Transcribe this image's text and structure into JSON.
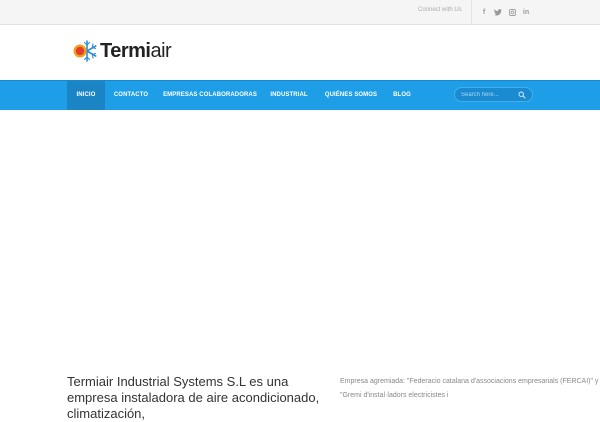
{
  "topbar": {
    "connect_label": "Connect with Us",
    "social": [
      {
        "name": "facebook-icon",
        "glyph": "f"
      },
      {
        "name": "twitter-icon",
        "glyph": "t"
      },
      {
        "name": "instagram-icon",
        "glyph": "◎"
      },
      {
        "name": "linkedin-icon",
        "glyph": "in"
      }
    ]
  },
  "brand": {
    "name_bold": "Termi",
    "name_light": "air"
  },
  "nav": {
    "items": [
      {
        "label": "INICIO",
        "active": true
      },
      {
        "label": "CONTACTO",
        "active": false
      },
      {
        "label": "EMPRESAS COLABORADORAS",
        "active": false
      },
      {
        "label": "INDUSTRIAL",
        "active": false
      },
      {
        "label": "QUIÉNES SOMOS",
        "active": false
      },
      {
        "label": "BLOG",
        "active": false
      }
    ],
    "search_placeholder": "Search here..."
  },
  "content": {
    "intro": "Termiair Industrial Systems S.L es una empresa instaladora de aire acondicionado, climatización,",
    "aside": "Empresa agremiada: \"Federacio catalana d'associacions empresarials (FERCAI)\" y \"Gremi d'instal·ladors electricistes i"
  },
  "colors": {
    "nav_bg": "#1e9ee6",
    "nav_active": "#1a84c5",
    "topbar_bg": "#f5f5f5"
  }
}
